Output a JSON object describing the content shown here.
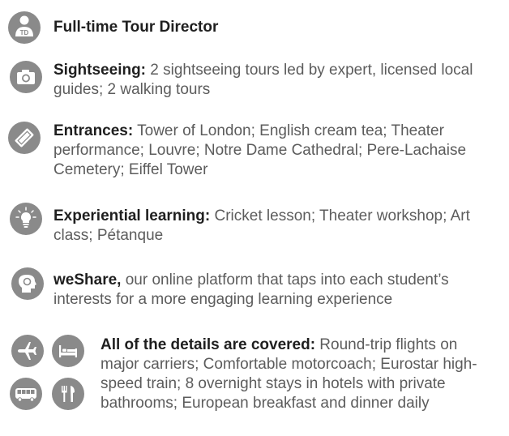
{
  "colors": {
    "icon_bg": "#8a8a8a",
    "bold_text": "#1f1f1f",
    "body_text": "#5c5c5c"
  },
  "items": [
    {
      "icon": "tour-director-icon",
      "badge": "TD",
      "title": "Full-time Tour Director",
      "body": ""
    },
    {
      "icon": "camera-icon",
      "title": "Sightseeing:",
      "body": " 2 sightseeing tours led by expert, licensed local guides; 2 walking tours"
    },
    {
      "icon": "ticket-icon",
      "title": "Entrances:",
      "body": " Tower of London; English cream tea; Theater performance; Louvre; Notre Dame Cathedral; Pere-Lachaise Cemetery; Eiffel Tower"
    },
    {
      "icon": "lightbulb-icon",
      "title": "Experiential learning:",
      "body": " Cricket lesson; Theater workshop; Art class; Pétanque"
    },
    {
      "icon": "head-icon",
      "title": "weShare,",
      "body": " our online platform that taps into each student’s interests for a more engaging learning experience"
    },
    {
      "icons": [
        "airplane-icon",
        "bed-icon",
        "bus-icon",
        "utensils-icon"
      ],
      "title": "All of the details are covered:",
      "body": " Round-trip flights on major carriers; Comfortable motorcoach; Eurostar high-speed train; 8 overnight stays in hotels with private bathrooms; European breakfast and dinner daily"
    }
  ]
}
